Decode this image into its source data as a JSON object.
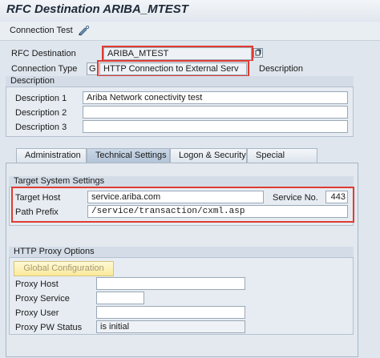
{
  "window": {
    "title": "RFC Destination ARIBA_MTEST"
  },
  "toolbar": {
    "connection_test_label": "Connection Test"
  },
  "header": {
    "rfc_destination_label": "RFC Destination",
    "rfc_destination_value": "ARIBA_MTEST",
    "connection_type_label": "Connection Type",
    "connection_type_code": "G",
    "connection_type_value": "HTTP Connection to External Serv",
    "description_label": "Description"
  },
  "description_group": {
    "title": "Description",
    "rows": [
      {
        "label": "Description 1",
        "value": "Ariba Network conectivity test"
      },
      {
        "label": "Description 2",
        "value": ""
      },
      {
        "label": "Description 3",
        "value": ""
      }
    ]
  },
  "tabs": [
    {
      "label": "Administration",
      "active": false
    },
    {
      "label": "Technical Settings",
      "active": true
    },
    {
      "label": "Logon & Security",
      "active": false
    },
    {
      "label": "Special Options",
      "active": false
    }
  ],
  "target_system": {
    "title": "Target System Settings",
    "host_label": "Target Host",
    "host_value": "service.ariba.com",
    "service_no_label": "Service No.",
    "service_no_value": "443",
    "path_prefix_label": "Path Prefix",
    "path_prefix_value": "/service/transaction/cxml.asp"
  },
  "proxy": {
    "title": "HTTP Proxy Options",
    "global_config_label": "Global Configuration",
    "rows": [
      {
        "label": "Proxy Host",
        "value": ""
      },
      {
        "label": "Proxy Service",
        "value": ""
      },
      {
        "label": "Proxy User",
        "value": ""
      },
      {
        "label": "Proxy PW Status",
        "value": "is initial"
      }
    ]
  },
  "colors": {
    "highlight": "#e03c31",
    "background": "#dfe6ee",
    "tab_active": "#b3c4d7"
  }
}
